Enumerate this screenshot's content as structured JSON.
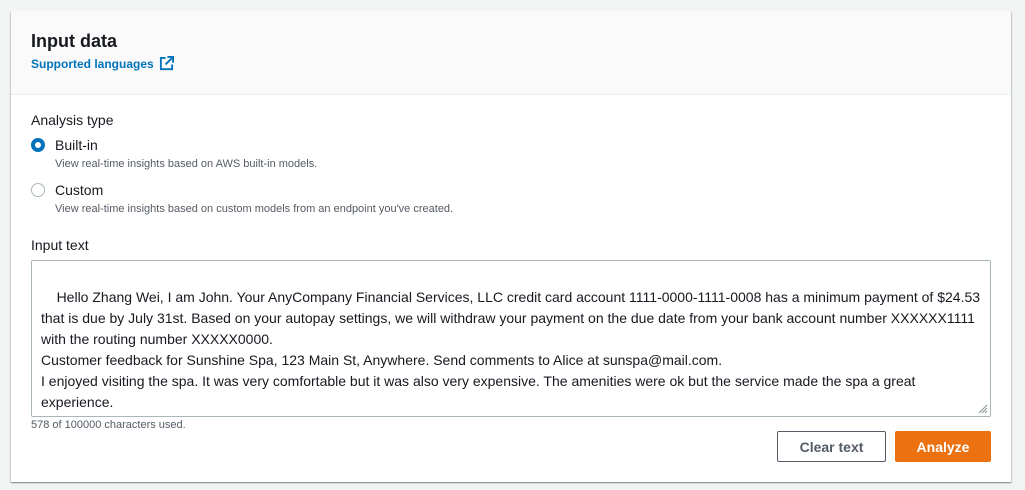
{
  "header": {
    "title": "Input data",
    "link_label": "Supported languages"
  },
  "analysis": {
    "label": "Analysis type",
    "options": [
      {
        "label": "Built-in",
        "description": "View real-time insights based on AWS built-in models.",
        "selected": true
      },
      {
        "label": "Custom",
        "description": "View real-time insights based on custom models from an endpoint you've created.",
        "selected": false
      }
    ]
  },
  "input": {
    "label": "Input text",
    "value": "Hello Zhang Wei, I am John. Your AnyCompany Financial Services, LLC credit card account 1111-0000-1111-0008 has a minimum payment of $24.53 that is due by July 31st. Based on your autopay settings, we will withdraw your payment on the due date from your bank account number XXXXXX1111 with the routing number XXXXX0000.\nCustomer feedback for Sunshine Spa, 123 Main St, Anywhere. Send comments to Alice at sunspa@mail.com.\nI enjoyed visiting the spa. It was very comfortable but it was also very expensive. The amenities were ok but the service made the spa a great experience.",
    "char_count": "578 of 100000 characters used."
  },
  "actions": {
    "clear_label": "Clear text",
    "analyze_label": "Analyze"
  },
  "colors": {
    "link": "#0073bb",
    "primary_button": "#ec7211",
    "radio_selected": "#0073bb"
  },
  "icons": {
    "link_icon": "external-link-icon",
    "textarea_grip": "resize-grip-icon"
  }
}
